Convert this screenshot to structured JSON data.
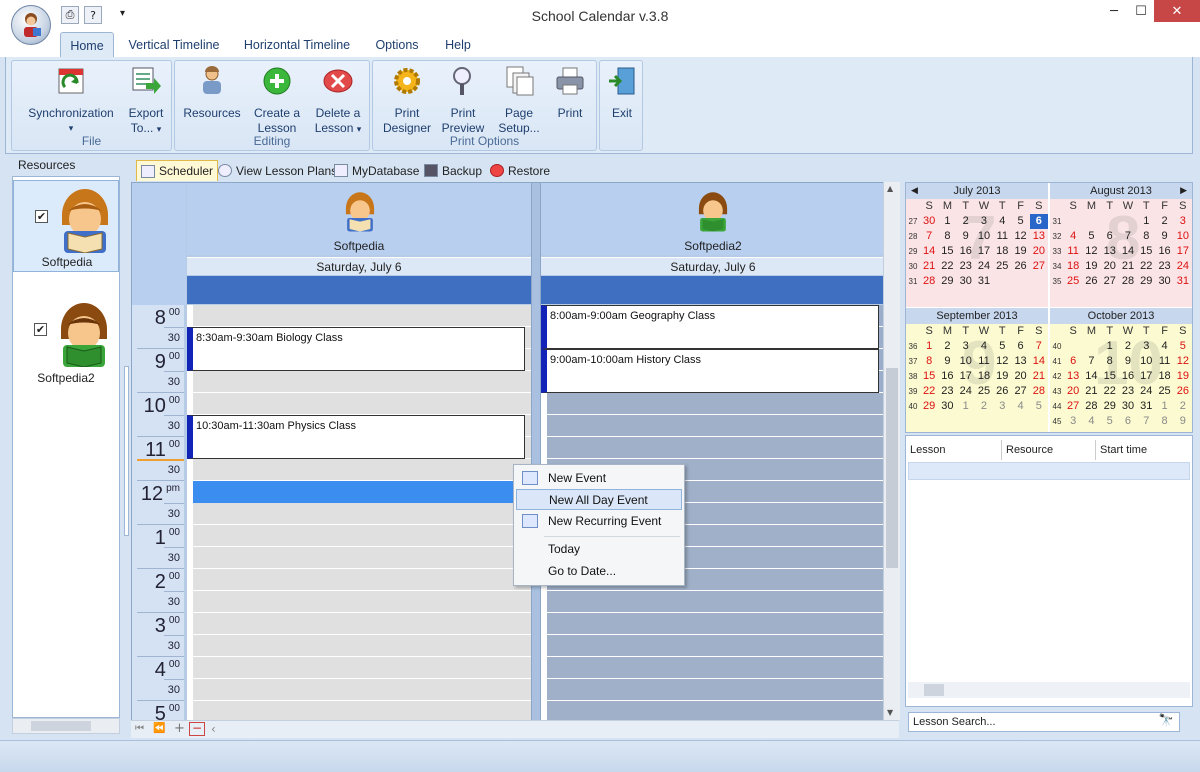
{
  "window": {
    "title": "School Calendar v.3.8",
    "minimize": "─",
    "maximize": "☐",
    "close": "✕",
    "qa_dropdown": "▾",
    "help_glyph": "?"
  },
  "ribbon": {
    "tabs": [
      "Home",
      "Vertical Timeline",
      "Horizontal Timeline",
      "Options",
      "Help"
    ],
    "groups": {
      "file": "File",
      "editing": "Editing",
      "print": "Print Options"
    },
    "buttons": {
      "sync": "Synchronization",
      "sync_arrow": "▾",
      "export1": "Export",
      "export2": "To...",
      "export_arrow": "▾",
      "resources": "Resources",
      "create1": "Create a",
      "create2": "Lesson",
      "delete1": "Delete a",
      "delete2": "Lesson",
      "delete_arrow": "▾",
      "pd1": "Print",
      "pd2": "Designer",
      "pp1": "Print",
      "pp2": "Preview",
      "ps1": "Page",
      "ps2": "Setup...",
      "print": "Print",
      "exit": "Exit"
    }
  },
  "resources": {
    "header": "Resources",
    "items": [
      {
        "name": "Softpedia",
        "checked": "✔"
      },
      {
        "name": "Softpedia2",
        "checked": "✔"
      }
    ],
    "collapse": "‹"
  },
  "doc_tabs": [
    "Scheduler",
    "View Lesson Plans",
    "MyDatabase",
    "Backup",
    "Restore"
  ],
  "scheduler": {
    "columns": [
      {
        "name": "Softpedia",
        "date": "Saturday, July 6"
      },
      {
        "name": "Softpedia2",
        "date": "Saturday, July 6"
      }
    ],
    "hours": [
      {
        "h": "8",
        "s": "00"
      },
      {
        "h": "9",
        "s": "00"
      },
      {
        "h": "10",
        "s": "00"
      },
      {
        "h": "11",
        "s": "00"
      },
      {
        "h": "12",
        "s": "pm"
      },
      {
        "h": "1",
        "s": "00"
      },
      {
        "h": "2",
        "s": "00"
      },
      {
        "h": "3",
        "s": "00"
      },
      {
        "h": "4",
        "s": "00"
      },
      {
        "h": "5",
        "s": "00"
      }
    ],
    "half_label": "30",
    "events": {
      "e1": "8:30am-9:30am Biology Class",
      "e2": "10:30am-11:30am Physics Class",
      "e3": "8:00am-9:00am Geography Class",
      "e4": "9:00am-10:00am History Class"
    },
    "nav": {
      "first": "⏮",
      "prev": "⏪",
      "add": "+",
      "remove": "−",
      "left": "‹",
      "up": "▲",
      "down": "▼"
    }
  },
  "context_menu": {
    "new_event": "New Event",
    "new_all_day": "New All Day Event",
    "new_recurring": "New Recurring Event",
    "today": "Today",
    "goto": "Go to Date..."
  },
  "calendar": {
    "dow": [
      "S",
      "M",
      "T",
      "W",
      "T",
      "F",
      "S"
    ],
    "months": [
      {
        "title": "July 2013",
        "bg": "7",
        "weeks": [
          [
            "27",
            "30",
            "1",
            "2",
            "3",
            "4",
            "5",
            "6"
          ],
          [
            "28",
            "7",
            "8",
            "9",
            "10",
            "11",
            "12",
            "13"
          ],
          [
            "29",
            "14",
            "15",
            "16",
            "17",
            "18",
            "19",
            "20"
          ],
          [
            "30",
            "21",
            "22",
            "23",
            "24",
            "25",
            "26",
            "27"
          ],
          [
            "31",
            "28",
            "29",
            "30",
            "31",
            "",
            ""
          ]
        ]
      },
      {
        "title": "August 2013",
        "bg": "8",
        "weeks": [
          [
            "31",
            "",
            "",
            "",
            "",
            "1",
            "2",
            "3"
          ],
          [
            "32",
            "4",
            "5",
            "6",
            "7",
            "8",
            "9",
            "10"
          ],
          [
            "33",
            "11",
            "12",
            "13",
            "14",
            "15",
            "16",
            "17"
          ],
          [
            "34",
            "18",
            "19",
            "20",
            "21",
            "22",
            "23",
            "24"
          ],
          [
            "35",
            "25",
            "26",
            "27",
            "28",
            "29",
            "30",
            "31"
          ]
        ]
      },
      {
        "title": "September 2013",
        "bg": "9",
        "weeks": [
          [
            "36",
            "1",
            "2",
            "3",
            "4",
            "5",
            "6",
            "7"
          ],
          [
            "37",
            "8",
            "9",
            "10",
            "11",
            "12",
            "13",
            "14"
          ],
          [
            "38",
            "15",
            "16",
            "17",
            "18",
            "19",
            "20",
            "21"
          ],
          [
            "39",
            "22",
            "23",
            "24",
            "25",
            "26",
            "27",
            "28"
          ],
          [
            "40",
            "29",
            "30",
            "1",
            "2",
            "3",
            "4",
            "5"
          ]
        ]
      },
      {
        "title": "October 2013",
        "bg": "10",
        "weeks": [
          [
            "40",
            "",
            "",
            "1",
            "2",
            "3",
            "4",
            "5"
          ],
          [
            "41",
            "6",
            "7",
            "8",
            "9",
            "10",
            "11",
            "12"
          ],
          [
            "42",
            "13",
            "14",
            "15",
            "16",
            "17",
            "18",
            "19"
          ],
          [
            "43",
            "20",
            "21",
            "22",
            "23",
            "24",
            "25",
            "26"
          ],
          [
            "44",
            "27",
            "28",
            "29",
            "30",
            "31",
            "1",
            "2"
          ],
          [
            "45",
            "3",
            "4",
            "5",
            "6",
            "7",
            "8",
            "9"
          ]
        ]
      }
    ],
    "prev": "◀",
    "next": "▶"
  },
  "lesson_grid": {
    "columns": [
      "Lesson",
      "Resource",
      "Start time"
    ]
  },
  "search": {
    "placeholder": "Lesson Search...",
    "button_glyph": "🔭"
  }
}
